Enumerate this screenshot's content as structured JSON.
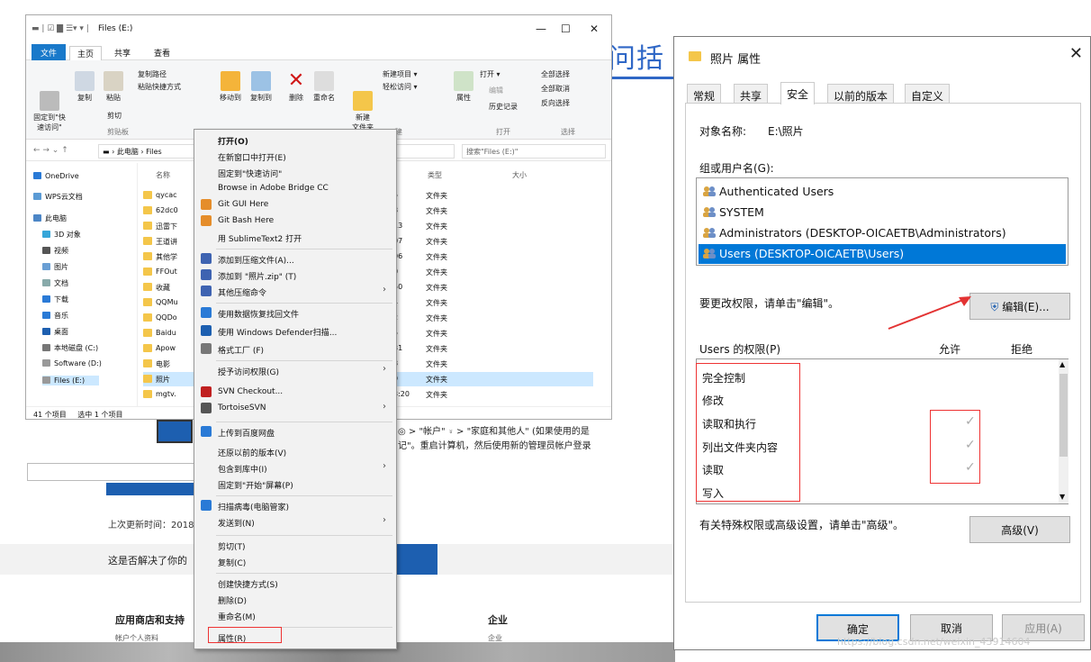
{
  "background_page": {
    "title_fragment": "问括",
    "path_text_1": "◎ > \"帐户\" ⍤ > \"家庭和其他人\" (如果使用的是",
    "path_text_2": "记\"。重启计算机，然后使用新的管理员帐户登录",
    "last_updated": "上次更新时间：2018",
    "helpful": "这是否解决了你的",
    "footer_col1": "应用商店和支持",
    "footer_col2": "企业",
    "footer_sub1": "帐户个人资料",
    "footer_sub2": "企业"
  },
  "explorer": {
    "title": "Files (E:)",
    "qat": "▬ | ☑ ▇ ☰▾ ▾ |",
    "controls": [
      "—",
      "☐",
      "✕"
    ],
    "ribbon_tabs": [
      "文件",
      "主页",
      "共享",
      "查看"
    ],
    "ribbon": {
      "pin": "固定到\"快\n速访问\"",
      "copy": "复制",
      "paste": "粘贴",
      "copy_path": "复制路径",
      "paste_shortcut": "粘贴快捷方式",
      "cut": "剪切",
      "clipboard_group": "剪贴板",
      "move_to": "移动到",
      "copy_to": "复制到",
      "delete": "删除",
      "rename": "重命名",
      "new_folder": "新建\n文件夹",
      "new_item": "新建项目 ▾",
      "easy_access": "轻松访问 ▾",
      "new_group": "建",
      "properties": "属性",
      "open": "打开 ▾",
      "edit": "编辑",
      "history": "历史记录",
      "open_group": "打开",
      "select_all": "全部选择",
      "select_none": "全部取消",
      "invert": "反向选择",
      "select_group": "选择"
    },
    "address": "▬ › 此电脑 › Files",
    "search_placeholder": "搜索\"Files (E:)\"",
    "nav": [
      "OneDrive",
      "WPS云文档",
      "此电脑",
      "3D 对象",
      "视频",
      "图片",
      "文档",
      "下载",
      "音乐",
      "桌面",
      "本地磁盘 (C:)",
      "Software (D:)",
      "Files (E:)"
    ],
    "columns": {
      "name": "名称",
      "type": "类型",
      "size": "大小"
    },
    "rows": [
      {
        "name": "qycac",
        "date": "5",
        "type": "文件夹"
      },
      {
        "name": "62dc0",
        "date": "8",
        "type": "文件夹"
      },
      {
        "name": "迅雷下",
        "date": "13",
        "type": "文件夹"
      },
      {
        "name": "王道讲",
        "date": "07",
        "type": "文件夹"
      },
      {
        "name": "其他学",
        "date": "06",
        "type": "文件夹"
      },
      {
        "name": "FFOut",
        "date": "0",
        "type": "文件夹"
      },
      {
        "name": "收藏",
        "date": "50",
        "type": "文件夹"
      },
      {
        "name": "QQMu",
        "date": "4",
        "type": "文件夹"
      },
      {
        "name": "QQDo",
        "date": "2",
        "type": "文件夹"
      },
      {
        "name": "Baidu",
        "date": "5",
        "type": "文件夹"
      },
      {
        "name": "Apow",
        "date": "31",
        "type": "文件夹"
      },
      {
        "name": "电影",
        "date": "8",
        "type": "文件夹"
      },
      {
        "name": "照片",
        "date": "9",
        "type": "文件夹"
      },
      {
        "name": "mgtv.",
        "date": "3:20",
        "type": "文件夹"
      }
    ],
    "status_count": "41 个项目",
    "status_selected": "选中 1 个项目"
  },
  "context_menu": {
    "items": [
      "打开(O)",
      "在新窗口中打开(E)",
      "固定到\"快速访问\"",
      "Browse in Adobe Bridge CC",
      "Git GUI Here",
      "Git Bash Here",
      "用 SublimeText2 打开",
      "添加到压缩文件(A)...",
      "添加到 \"照片.zip\" (T)",
      "其他压缩命令",
      "使用数据恢复找回文件",
      "使用 Windows Defender扫描...",
      "格式工厂 (F)",
      "授予访问权限(G)",
      "SVN Checkout...",
      "TortoiseSVN",
      "上传到百度网盘",
      "还原以前的版本(V)",
      "包含到库中(I)",
      "固定到\"开始\"屏幕(P)",
      "扫描病毒(电脑管家)",
      "发送到(N)",
      "剪切(T)",
      "复制(C)",
      "创建快捷方式(S)",
      "删除(D)",
      "重命名(M)",
      "属性(R)"
    ]
  },
  "dialog": {
    "title": "照片 属性",
    "close": "✕",
    "tabs": [
      "常规",
      "共享",
      "安全",
      "以前的版本",
      "自定义"
    ],
    "object_label": "对象名称:",
    "object_value": "E:\\照片",
    "group_label": "组或用户名(G):",
    "users": [
      "Authenticated Users",
      "SYSTEM",
      "Administrators (DESKTOP-OICAETB\\Administrators)",
      "Users (DESKTOP-OICAETB\\Users)"
    ],
    "change_hint": "要更改权限，请单击\"编辑\"。",
    "edit_button": "编辑(E)...",
    "perm_label": "Users 的权限(P)",
    "allow": "允许",
    "deny": "拒绝",
    "permissions": [
      "完全控制",
      "修改",
      "读取和执行",
      "列出文件夹内容",
      "读取",
      "写入"
    ],
    "checkmark": "✓",
    "advanced_hint": "有关特殊权限或高级设置，请单击\"高级\"。",
    "advanced_button": "高级(V)",
    "ok": "确定",
    "cancel": "取消",
    "apply": "应用(A)",
    "annotation_color": "#e33333"
  },
  "watermark": "https://blog.csdn.net/weixin_43914604"
}
